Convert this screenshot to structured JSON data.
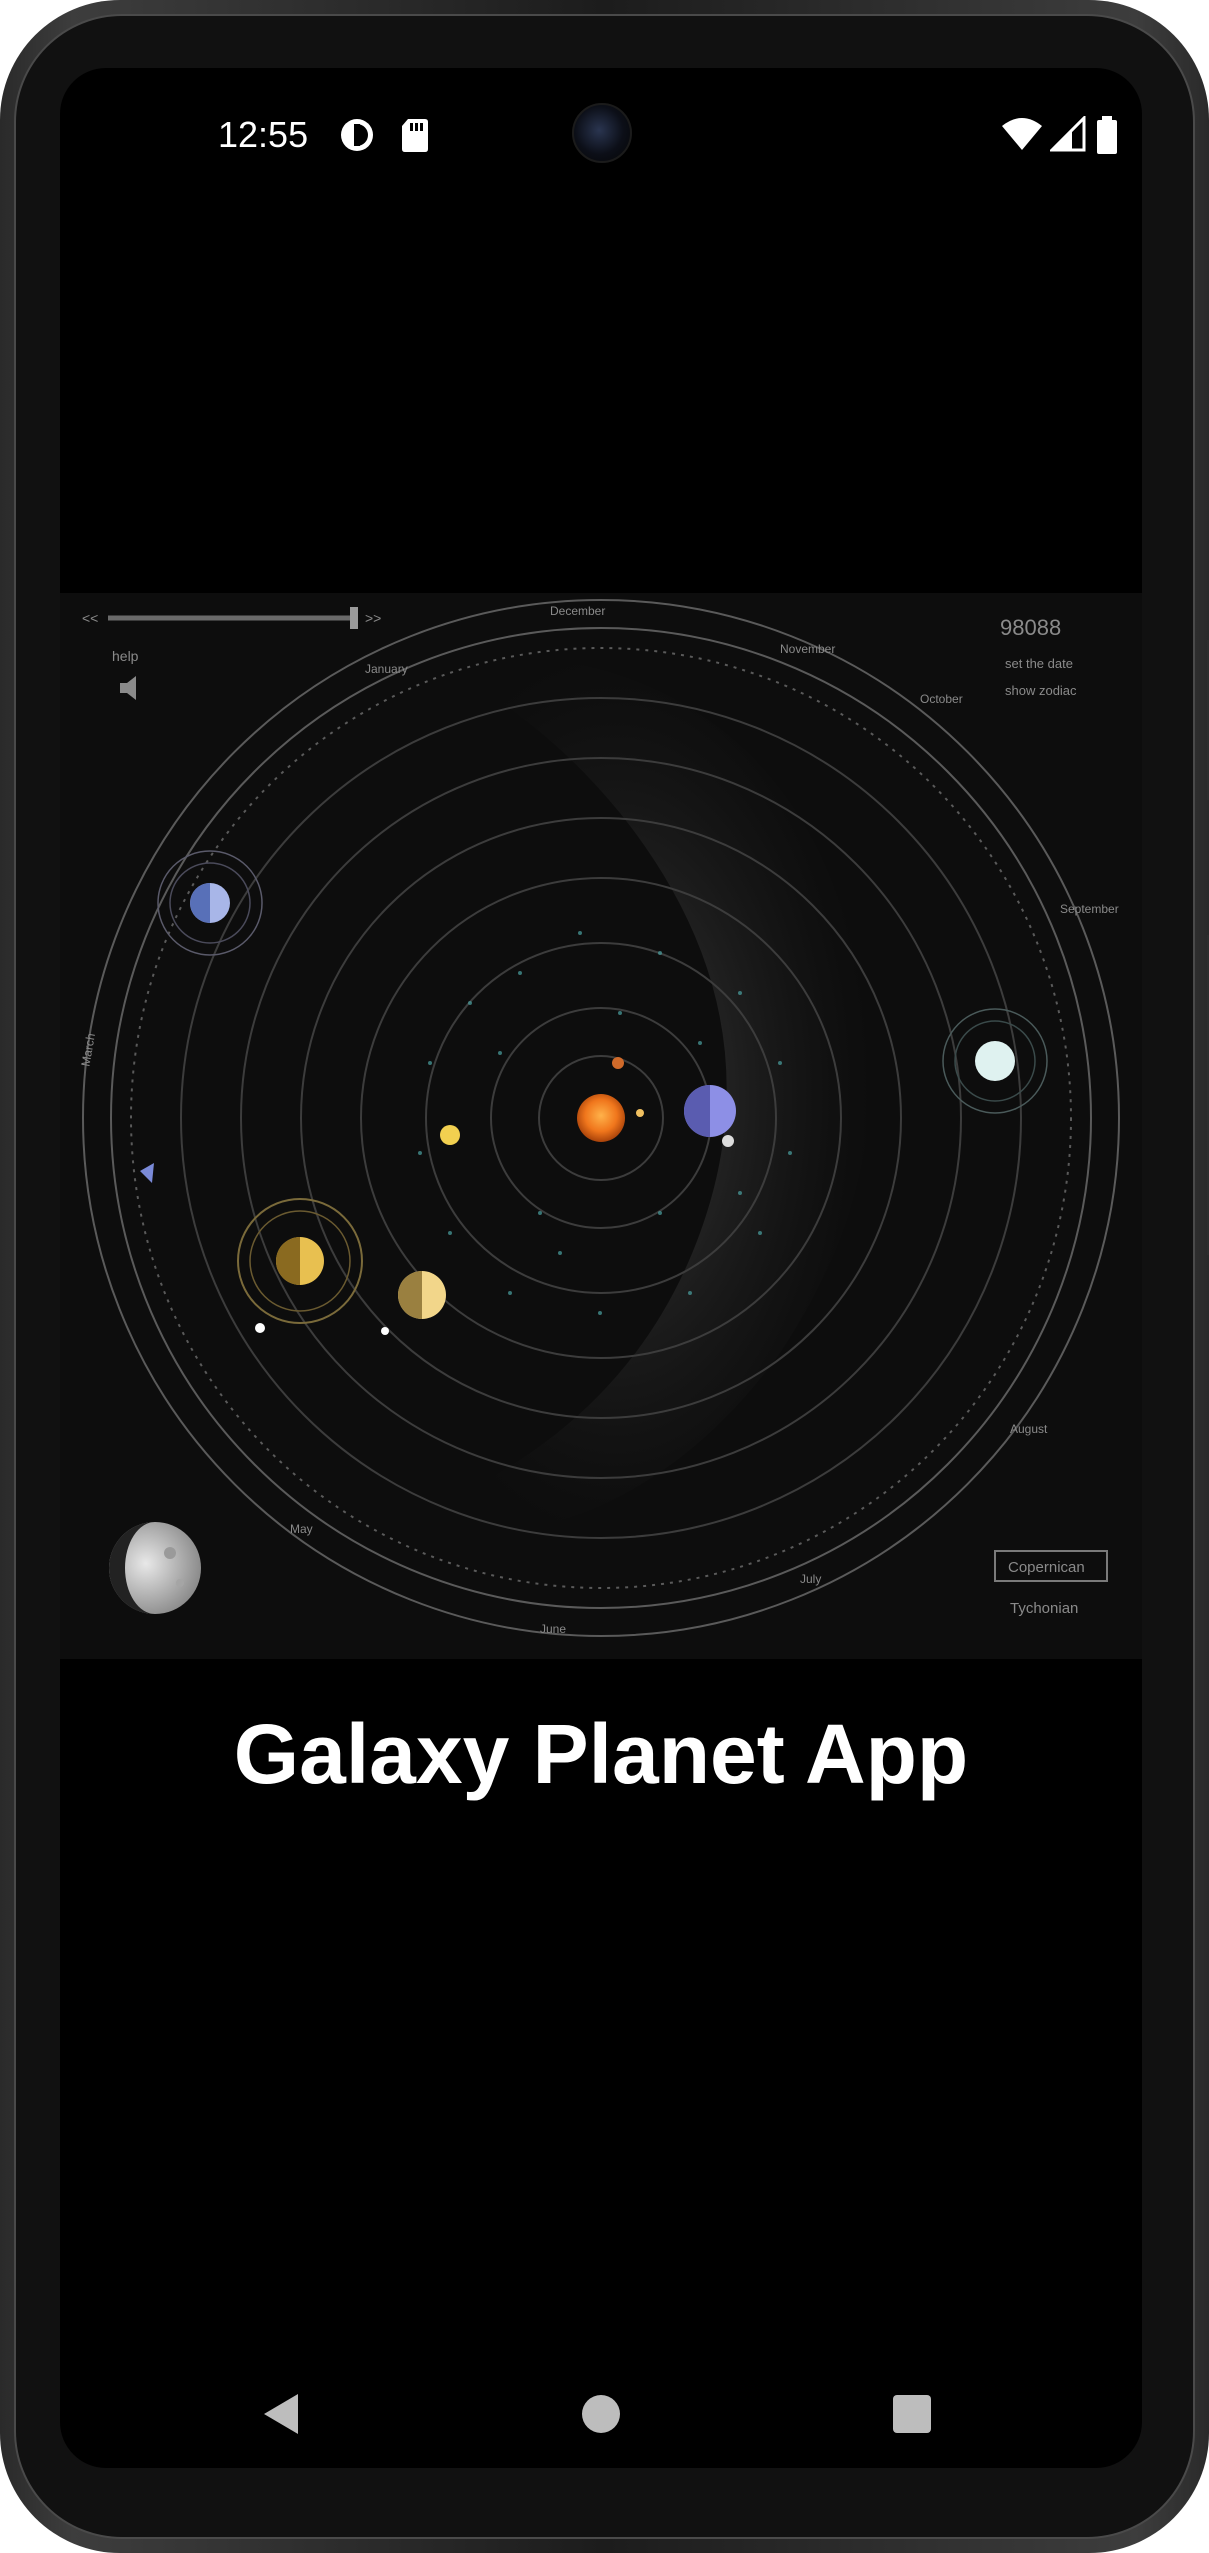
{
  "status_bar": {
    "time": "12:55",
    "left_icons": [
      "data-saver-icon",
      "sd-card-icon"
    ],
    "right_icons": [
      "wifi-icon",
      "cellular-signal-icon",
      "battery-icon"
    ]
  },
  "hero": {
    "counter": "98088",
    "links": [
      "set the date",
      "show zodiac"
    ],
    "help_label": "help",
    "months": [
      "December",
      "January",
      "March",
      "May",
      "June",
      "July",
      "August",
      "September",
      "October",
      "November"
    ],
    "modes": [
      "Copernican",
      "Tychonian"
    ]
  },
  "title": "Galaxy Planet App",
  "nav": {
    "back": "back-icon",
    "home": "home-icon",
    "recents": "recents-icon"
  },
  "colors": {
    "screen_bg": "#000000",
    "title_text": "#ffffff",
    "sun": "#f28a2a"
  }
}
